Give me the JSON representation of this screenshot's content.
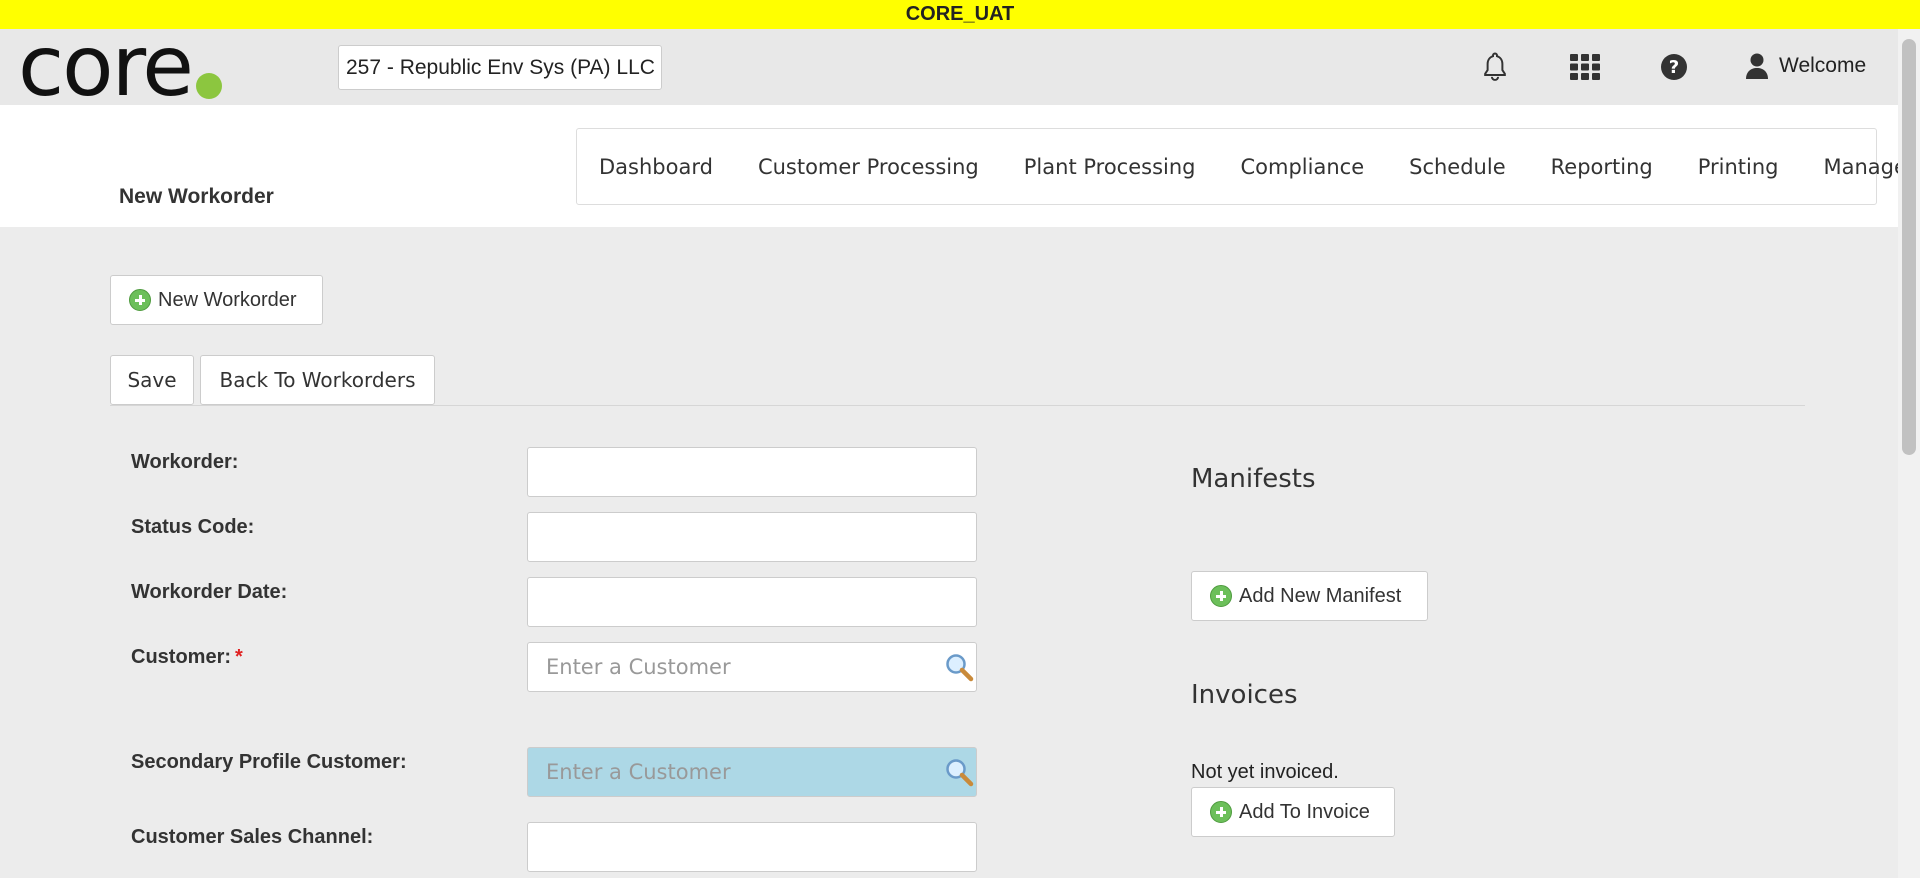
{
  "env_banner": "CORE_UAT",
  "logo": {
    "text": "core"
  },
  "company_selector": {
    "value": "257 - Republic Env Sys (PA) LLC"
  },
  "header_icons": [
    "bell-icon",
    "apps-grid-icon",
    "help-icon",
    "user-icon"
  ],
  "user": {
    "welcome_label": "Welcome"
  },
  "page": {
    "title": "New Workorder"
  },
  "nav": {
    "items": [
      {
        "label": "Dashboard"
      },
      {
        "label": "Customer Processing"
      },
      {
        "label": "Plant Processing"
      },
      {
        "label": "Compliance"
      },
      {
        "label": "Schedule"
      },
      {
        "label": "Reporting"
      },
      {
        "label": "Printing"
      },
      {
        "label": "Manage"
      }
    ]
  },
  "toolbar": {
    "new_workorder_label": "New Workorder",
    "save_label": "Save",
    "back_label": "Back To Workorders"
  },
  "form": {
    "fields": [
      {
        "label": "Workorder:",
        "value": ""
      },
      {
        "label": "Status Code:",
        "value": ""
      },
      {
        "label": "Workorder Date:",
        "value": ""
      },
      {
        "label": "Customer:",
        "required_mark": "*",
        "value": "",
        "placeholder": "Enter a Customer"
      },
      {
        "label": "Secondary Profile Customer:",
        "value": "",
        "placeholder": "Enter a Customer"
      },
      {
        "label": "Customer Sales Channel:",
        "value": ""
      }
    ]
  },
  "manifests": {
    "title": "Manifests",
    "add_label": "Add New Manifest"
  },
  "invoices": {
    "title": "Invoices",
    "status_text": "Not yet invoiced.",
    "add_label": "Add To Invoice"
  },
  "colors": {
    "banner": "#ffff00",
    "logo_dot": "#8cc63f",
    "highlight_input": "#add8e6",
    "required": "#e02020"
  }
}
